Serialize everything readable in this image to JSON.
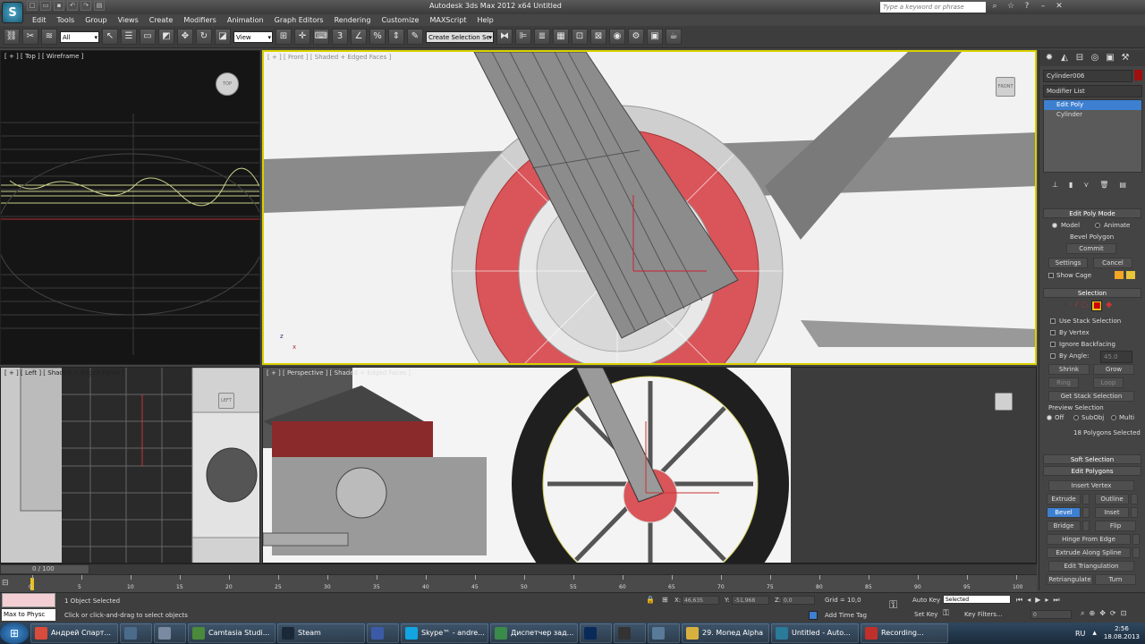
{
  "app": {
    "logo": "S",
    "title": "Autodesk 3ds Max  2012 x64    Untitled",
    "search_placeholder": "Type a keyword or phrase"
  },
  "quick_access": [
    "new-icon",
    "open-icon",
    "save-icon",
    "undo-icon",
    "redo-icon",
    "project-icon"
  ],
  "menu": [
    "Edit",
    "Tools",
    "Group",
    "Views",
    "Create",
    "Modifiers",
    "Animation",
    "Graph Editors",
    "Rendering",
    "Customize",
    "MAXScript",
    "Help"
  ],
  "toolbar": {
    "selection_filter": "All",
    "ref_coord": "View",
    "named_selection": "Create Selection Se"
  },
  "viewports": {
    "top": {
      "label": "[ + ] [ Top ] [ Wireframe ]",
      "cube": "TOP"
    },
    "front": {
      "label": "[ + ] [ Front ] [ Shaded + Edged Faces ]",
      "cube": "FRONT"
    },
    "left": {
      "label": "[ + ] [ Left ] [ Shaded + Edged Faces ]",
      "cube": "LEFT"
    },
    "perspective": {
      "label": "[ + ] [ Perspective ] [ Shaded + Edged Faces ]",
      "cube": ""
    }
  },
  "command_panel": {
    "object_name": "Cylinder006",
    "modifier_list": "Modifier List",
    "stack": [
      "Edit Poly",
      "Cylinder"
    ],
    "edit_poly_mode": {
      "title": "Edit Poly Mode",
      "model": "Model",
      "animate": "Animate",
      "bevel_polygon": "Bevel Polygon",
      "commit": "Commit",
      "settings": "Settings",
      "cancel": "Cancel",
      "show_cage": "Show Cage"
    },
    "selection": {
      "title": "Selection",
      "use_stack": "Use Stack Selection",
      "by_vertex": "By Vertex",
      "ignore_backfacing": "Ignore Backfacing",
      "by_angle": "By Angle:",
      "angle_value": "45.0",
      "shrink": "Shrink",
      "grow": "Grow",
      "ring": "Ring",
      "loop": "Loop",
      "get_stack": "Get Stack Selection",
      "preview": "Preview Selection",
      "off": "Off",
      "subobj": "SubObj",
      "multi": "Multi",
      "status": "18 Polygons Selected"
    },
    "soft_selection": "Soft Selection",
    "edit_polygons": {
      "title": "Edit Polygons",
      "insert_vertex": "Insert Vertex",
      "extrude": "Extrude",
      "outline": "Outline",
      "bevel": "Bevel",
      "inset": "Inset",
      "bridge": "Bridge",
      "flip": "Flip",
      "hinge": "Hinge From Edge",
      "extrude_spline": "Extrude Along Spline",
      "edit_tri": "Edit Triangulation",
      "retriangulate": "Retriangulate",
      "turn": "Turn"
    }
  },
  "timeline": {
    "frame": "0 / 100",
    "ticks": [
      "0",
      "5",
      "10",
      "15",
      "20",
      "25",
      "30",
      "35",
      "40",
      "45",
      "50",
      "55",
      "60",
      "65",
      "70",
      "75",
      "80",
      "85",
      "90",
      "95",
      "100"
    ]
  },
  "status": {
    "maxscript": "Max to Physc",
    "objects_selected": "1 Object Selected",
    "prompt": "Click or click-and-drag to select objects",
    "x": "46,635",
    "y": "-51,968",
    "z": "0,0",
    "grid": "Grid = 10,0",
    "add_time_tag": "Add Time Tag",
    "auto_key": "Auto Key",
    "auto_key_value": "Selected",
    "set_key": "Set Key",
    "key_filters": "Key Filters...",
    "frame_value": "0"
  },
  "taskbar": {
    "items": [
      {
        "label": "Андрей Спарт...",
        "icon": "chrome-icon",
        "color": "#d94b3b"
      },
      {
        "label": "",
        "icon": "network-icon",
        "color": "#4b6b8b"
      },
      {
        "label": "",
        "icon": "notepad-icon",
        "color": "#7a8aa0"
      },
      {
        "label": "Camtasia Studi...",
        "icon": "camtasia-icon",
        "color": "#4a8a3a"
      },
      {
        "label": "Steam",
        "icon": "steam-icon",
        "color": "#1b2838"
      },
      {
        "label": "",
        "icon": "archive-icon",
        "color": "#3b5ba8"
      },
      {
        "label": "Skype™ - andre...",
        "icon": "skype-icon",
        "color": "#12a5e0"
      },
      {
        "label": "Диспетчер зад...",
        "icon": "taskmgr-icon",
        "color": "#3a8a4a"
      },
      {
        "label": "",
        "icon": "photoshop-icon",
        "color": "#0a2a5a"
      },
      {
        "label": "",
        "icon": "unity-icon",
        "color": "#333333"
      },
      {
        "label": "",
        "icon": "settings-icon",
        "color": "#5a7a9a"
      },
      {
        "label": "29. Мопед Alpha",
        "icon": "folder-icon",
        "color": "#d8b040"
      },
      {
        "label": "Untitled - Auto...",
        "icon": "3dsmax-icon",
        "color": "#2a7a9a"
      },
      {
        "label": "Recording...",
        "icon": "record-icon",
        "color": "#c0302a"
      }
    ],
    "lang": "RU",
    "time": "2:56",
    "date": "18.08.2013"
  },
  "colors": {
    "accent": "#3d7fd0",
    "selection_red": "#d9555a",
    "viewport_highlight": "#d8d000"
  }
}
